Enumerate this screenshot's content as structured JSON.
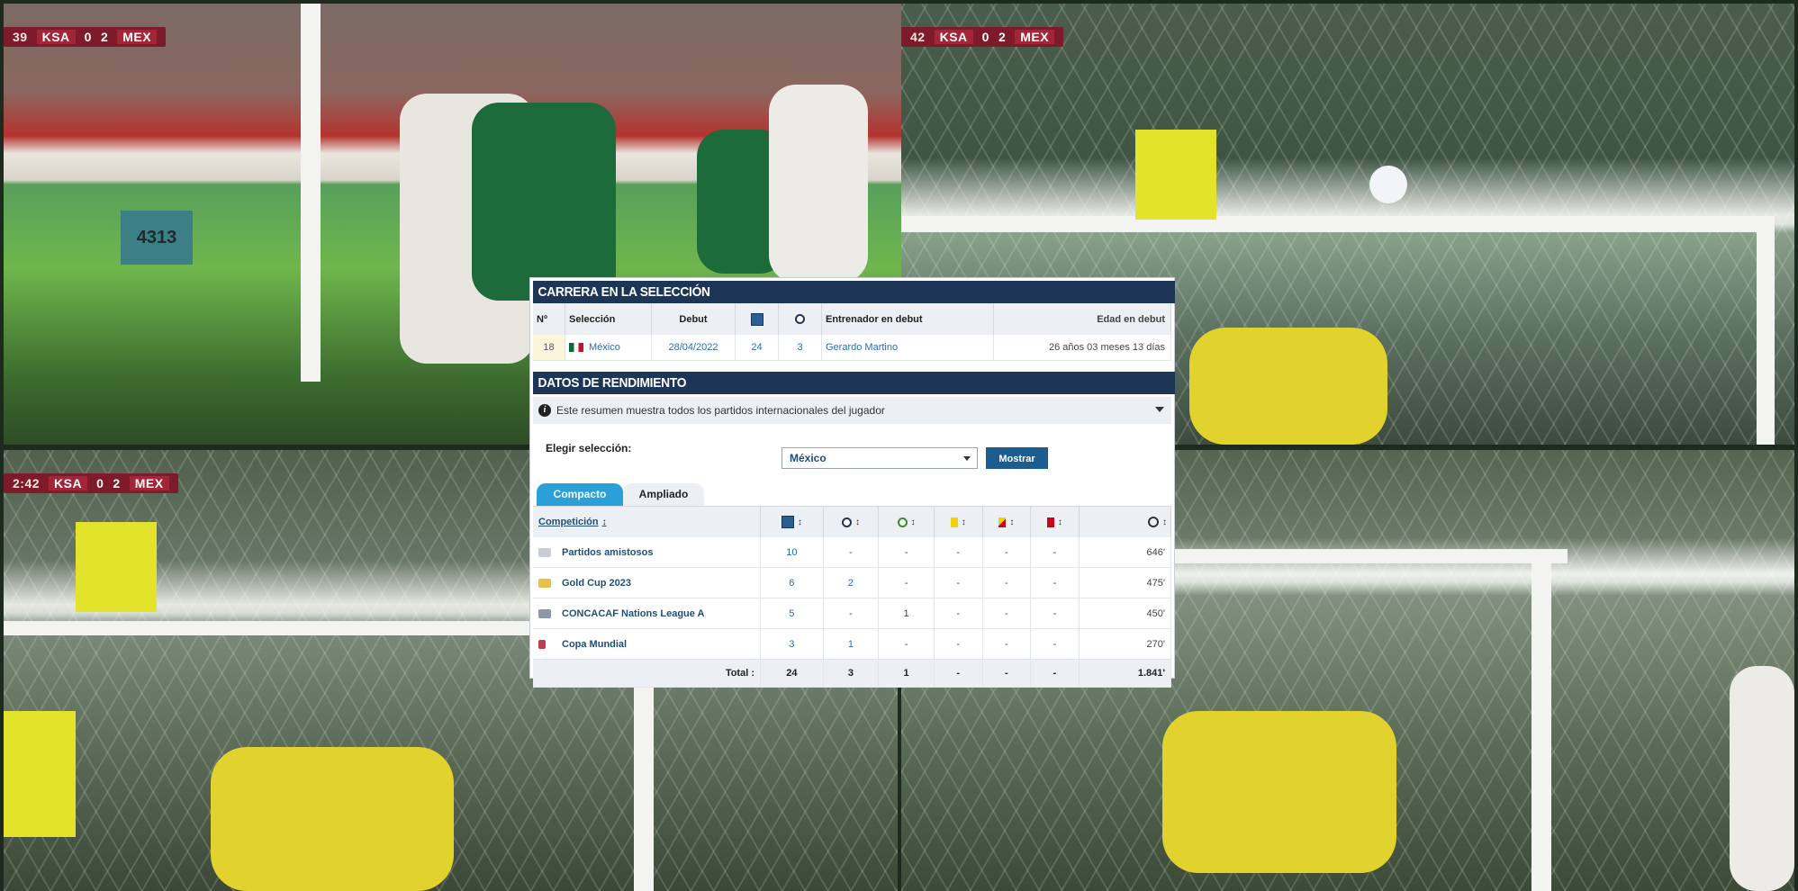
{
  "broadcast": {
    "frames": [
      {
        "time": "39",
        "home": "KSA",
        "home_score": "0",
        "away_score": "2",
        "away": "MEX"
      },
      {
        "time": "42",
        "home": "KSA",
        "home_score": "0",
        "away_score": "2",
        "away": "MEX"
      },
      {
        "time": "2:42",
        "home": "KSA",
        "home_score": "0",
        "away_score": "2",
        "away": "MEX"
      }
    ],
    "stadium_marking": "4313"
  },
  "career": {
    "title": "CARRERA EN LA SELECCIÓN",
    "headers": {
      "num": "Nº",
      "team": "Selección",
      "debut": "Debut",
      "matches_icon": "matches-icon",
      "goals_icon": "goals-icon",
      "coach": "Entrenador en debut",
      "age": "Edad en debut"
    },
    "row": {
      "num": "18",
      "team": "México",
      "debut": "28/04/2022",
      "matches": "24",
      "goals": "3",
      "coach": "Gerardo Martino",
      "age": "26 años 03 meses 13 días"
    }
  },
  "performance": {
    "title": "DATOS DE RENDIMIENTO",
    "info": "Este resumen muestra todos los partidos internacionales del jugador",
    "select_label": "Elegir selección:",
    "select_value": "México",
    "show_button": "Mostrar",
    "tabs": [
      "Compacto",
      "Ampliado"
    ],
    "columns": {
      "competition": "Competición",
      "sort": "↕"
    },
    "rows": [
      {
        "competition": "Partidos amistosos",
        "matches": "10",
        "goals": "-",
        "assists": "-",
        "yellow": "-",
        "second_yellow": "-",
        "red": "-",
        "minutes": "646'"
      },
      {
        "competition": "Gold Cup 2023",
        "matches": "6",
        "goals": "2",
        "assists": "-",
        "yellow": "-",
        "second_yellow": "-",
        "red": "-",
        "minutes": "475'"
      },
      {
        "competition": "CONCACAF Nations League A",
        "matches": "5",
        "goals": "-",
        "assists": "1",
        "yellow": "-",
        "second_yellow": "-",
        "red": "-",
        "minutes": "450'"
      },
      {
        "competition": "Copa Mundial",
        "matches": "3",
        "goals": "1",
        "assists": "-",
        "yellow": "-",
        "second_yellow": "-",
        "red": "-",
        "minutes": "270'"
      }
    ],
    "total": {
      "label": "Total :",
      "matches": "24",
      "goals": "3",
      "assists": "1",
      "yellow": "-",
      "second_yellow": "-",
      "red": "-",
      "minutes": "1.841'"
    }
  },
  "colors": {
    "header_bg": "#1d3557",
    "tab_active": "#2a9fd8",
    "button": "#1d5c8f",
    "link": "#2a6db0"
  }
}
